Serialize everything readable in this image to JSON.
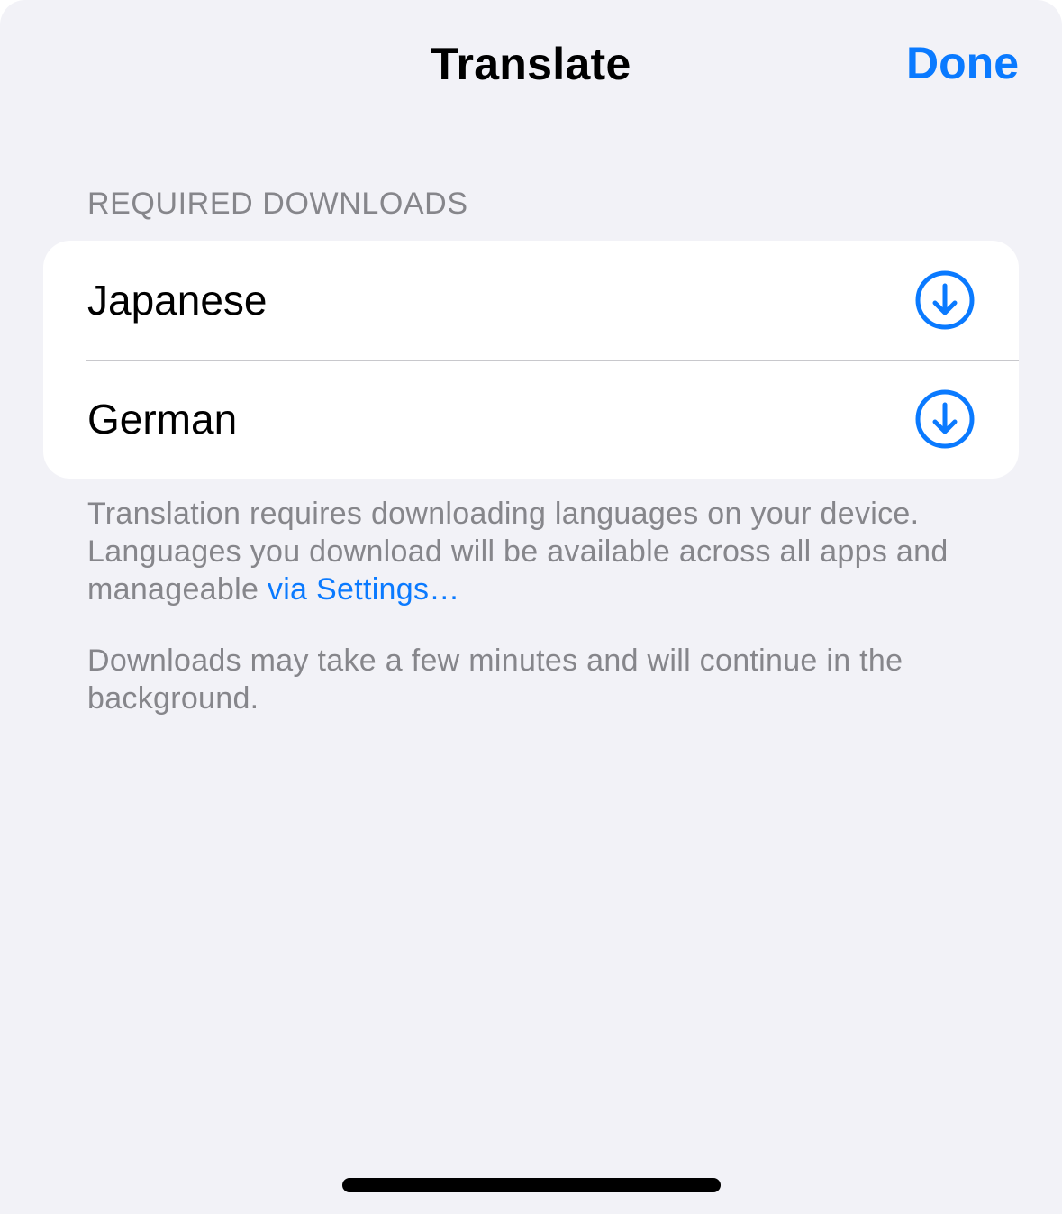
{
  "nav": {
    "title": "Translate",
    "done_label": "Done"
  },
  "section": {
    "header": "REQUIRED DOWNLOADS",
    "items": [
      {
        "label": "Japanese",
        "icon": "download-circle-icon"
      },
      {
        "label": "German",
        "icon": "download-circle-icon"
      }
    ]
  },
  "footer": {
    "line1_text": "Translation requires downloading languages on your device. Languages you download will be available across all apps and manageable ",
    "line1_link": "via Settings…",
    "line2_text": "Downloads may take a few minutes and will continue in the background."
  },
  "colors": {
    "accent": "#0a7aff",
    "background": "#f2f2f7",
    "secondary_text": "#86868b"
  }
}
